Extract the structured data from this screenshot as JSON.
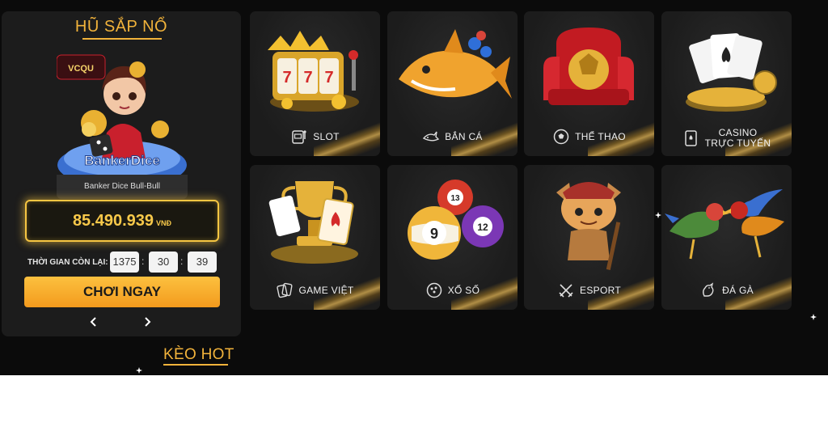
{
  "jackpot": {
    "title": "HŨ SẮP NỔ",
    "game": {
      "logo_text": "VCQU",
      "title_art": "BankerDice",
      "name": "Banker Dice Bull-Bull"
    },
    "amount": "85.490.939",
    "currency": "VNĐ",
    "timer_label": "THỜI GIAN CÒN LẠI:",
    "timer": {
      "hours": "1375",
      "minutes": "30",
      "seconds": "39"
    },
    "play_label": "CHƠI NGAY",
    "prev_icon": "chevron-left-icon",
    "next_icon": "chevron-right-icon"
  },
  "section_keo_hot": "KÈO HOT",
  "categories": [
    {
      "label": "SLOT",
      "icon": "slot-machine-icon"
    },
    {
      "label": "BẮN CÁ",
      "icon": "shark-icon"
    },
    {
      "label": "THỂ THAO",
      "icon": "soccer-ball-icon"
    },
    {
      "label_line1": "CASINO",
      "label_line2": "TRỰC TUYẾN",
      "icon": "playing-card-icon"
    },
    {
      "label": "GAME VIỆT",
      "icon": "card-hand-icon"
    },
    {
      "label": "XỔ SỐ",
      "icon": "lottery-balls-icon"
    },
    {
      "label": "ESPORT",
      "icon": "crossed-swords-icon"
    },
    {
      "label": "ĐÁ GÀ",
      "icon": "rooster-icon"
    }
  ],
  "art": {
    "jackpot_game": "Banker Dice character art",
    "slot": "777 slot machine with crown",
    "ban_ca": "golden shark",
    "the_thao": "golden ball on red throne",
    "casino": "playing cards on chips",
    "game_viet": "trophy with cards",
    "xo_so": "lottery balls 9 13 12",
    "esport": "esport character",
    "da_ga": "fighting roosters",
    "ball_numbers": [
      "13",
      "9",
      "12"
    ]
  },
  "colors": {
    "accent": "#f2b33b",
    "button": "#f9a825",
    "background": "#0b0b0b",
    "panel": "#1c1c1c"
  }
}
